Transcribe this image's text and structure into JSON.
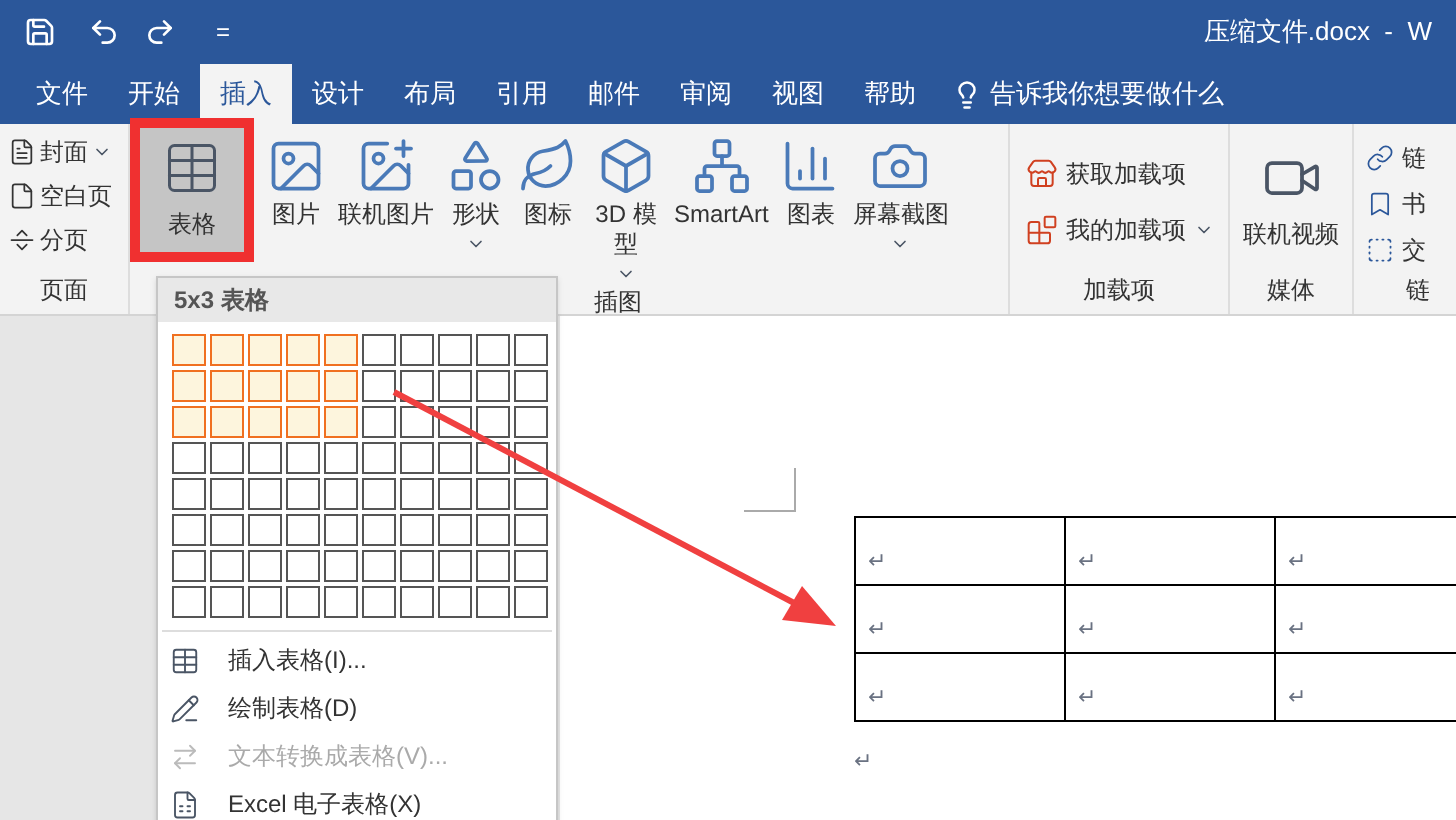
{
  "window": {
    "title": "压缩文件.docx  -  W",
    "qat_more": "="
  },
  "tabs": [
    {
      "label": "文件",
      "selected": false
    },
    {
      "label": "开始",
      "selected": false
    },
    {
      "label": "插入",
      "selected": true
    },
    {
      "label": "设计",
      "selected": false
    },
    {
      "label": "布局",
      "selected": false
    },
    {
      "label": "引用",
      "selected": false
    },
    {
      "label": "邮件",
      "selected": false
    },
    {
      "label": "审阅",
      "selected": false
    },
    {
      "label": "视图",
      "selected": false
    },
    {
      "label": "帮助",
      "selected": false
    }
  ],
  "tell_me": "告诉我你想要做什么",
  "ribbon": {
    "page_group": {
      "label": "页面",
      "items": [
        {
          "label": "封面",
          "dropdown": true
        },
        {
          "label": "空白页",
          "dropdown": false
        },
        {
          "label": "分页",
          "dropdown": false
        }
      ]
    },
    "table_button": {
      "label": "表格",
      "selected": true,
      "highlighted": true
    },
    "illustrations": {
      "label": "插图",
      "items": [
        {
          "label": "图片",
          "dropdown": false
        },
        {
          "label": "联机图片",
          "dropdown": false
        },
        {
          "label": "形状",
          "dropdown": true
        },
        {
          "label": "图标",
          "dropdown": false
        },
        {
          "label": "3D 模型",
          "dropdown": true
        },
        {
          "label": "SmartArt",
          "dropdown": false
        },
        {
          "label": "图表",
          "dropdown": false
        },
        {
          "label": "屏幕截图",
          "dropdown": true
        }
      ]
    },
    "addins": {
      "label": "加载项",
      "items": [
        {
          "label": "获取加载项",
          "dropdown": false
        },
        {
          "label": "我的加载项",
          "dropdown": true
        }
      ]
    },
    "media": {
      "label": "媒体",
      "items": [
        {
          "label": "联机视频"
        }
      ]
    },
    "links": {
      "label": "链",
      "items": [
        {
          "label": "链"
        },
        {
          "label": "书"
        },
        {
          "label": "交"
        }
      ]
    }
  },
  "table_menu": {
    "header": "5x3 表格",
    "grid": [
      {
        "cells": [
          {
            "selected": true
          },
          {
            "selected": true
          },
          {
            "selected": true
          },
          {
            "selected": true
          },
          {
            "selected": true
          },
          {
            "selected": false
          },
          {
            "selected": false
          },
          {
            "selected": false
          },
          {
            "selected": false
          },
          {
            "selected": false
          }
        ]
      },
      {
        "cells": [
          {
            "selected": true
          },
          {
            "selected": true
          },
          {
            "selected": true
          },
          {
            "selected": true
          },
          {
            "selected": true
          },
          {
            "selected": false
          },
          {
            "selected": false
          },
          {
            "selected": false
          },
          {
            "selected": false
          },
          {
            "selected": false
          }
        ]
      },
      {
        "cells": [
          {
            "selected": true
          },
          {
            "selected": true
          },
          {
            "selected": true
          },
          {
            "selected": true
          },
          {
            "selected": true
          },
          {
            "selected": false
          },
          {
            "selected": false
          },
          {
            "selected": false
          },
          {
            "selected": false
          },
          {
            "selected": false
          }
        ]
      },
      {
        "cells": [
          {
            "selected": false
          },
          {
            "selected": false
          },
          {
            "selected": false
          },
          {
            "selected": false
          },
          {
            "selected": false
          },
          {
            "selected": false
          },
          {
            "selected": false
          },
          {
            "selected": false
          },
          {
            "selected": false
          },
          {
            "selected": false
          }
        ]
      },
      {
        "cells": [
          {
            "selected": false
          },
          {
            "selected": false
          },
          {
            "selected": false
          },
          {
            "selected": false
          },
          {
            "selected": false
          },
          {
            "selected": false
          },
          {
            "selected": false
          },
          {
            "selected": false
          },
          {
            "selected": false
          },
          {
            "selected": false
          }
        ]
      },
      {
        "cells": [
          {
            "selected": false
          },
          {
            "selected": false
          },
          {
            "selected": false
          },
          {
            "selected": false
          },
          {
            "selected": false
          },
          {
            "selected": false
          },
          {
            "selected": false
          },
          {
            "selected": false
          },
          {
            "selected": false
          },
          {
            "selected": false
          }
        ]
      },
      {
        "cells": [
          {
            "selected": false
          },
          {
            "selected": false
          },
          {
            "selected": false
          },
          {
            "selected": false
          },
          {
            "selected": false
          },
          {
            "selected": false
          },
          {
            "selected": false
          },
          {
            "selected": false
          },
          {
            "selected": false
          },
          {
            "selected": false
          }
        ]
      },
      {
        "cells": [
          {
            "selected": false
          },
          {
            "selected": false
          },
          {
            "selected": false
          },
          {
            "selected": false
          },
          {
            "selected": false
          },
          {
            "selected": false
          },
          {
            "selected": false
          },
          {
            "selected": false
          },
          {
            "selected": false
          },
          {
            "selected": false
          }
        ]
      }
    ],
    "items": [
      {
        "label": "插入表格(I)...",
        "disabled": false
      },
      {
        "label": "绘制表格(D)",
        "disabled": false
      },
      {
        "label": "文本转换成表格(V)...",
        "disabled": true
      },
      {
        "label": "Excel 电子表格(X)",
        "disabled": false
      }
    ]
  },
  "document": {
    "table": [
      [
        "↵",
        "↵",
        "↵"
      ],
      [
        "↵",
        "↵",
        "↵"
      ],
      [
        "↵",
        "↵",
        "↵"
      ]
    ],
    "after_paragraph": "↵"
  }
}
